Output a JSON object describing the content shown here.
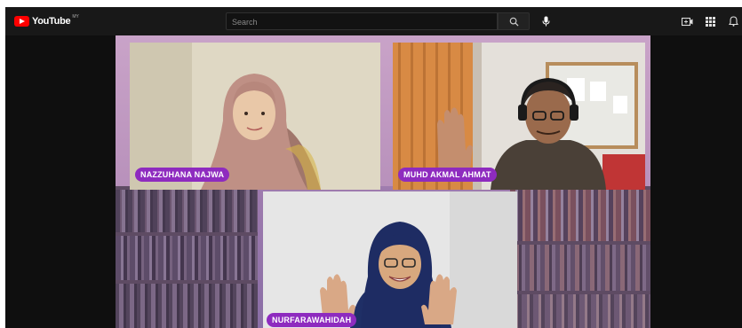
{
  "header": {
    "logo_text": "YouTube",
    "region_code": "MY",
    "search": {
      "placeholder": "Search",
      "value": ""
    },
    "icons": {
      "search": "search-icon",
      "mic": "mic-icon",
      "create": "create-video-icon",
      "apps": "apps-grid-icon",
      "notifications": "bell-icon"
    }
  },
  "video": {
    "participants": [
      {
        "name": "NAZZUHANA NAJWA"
      },
      {
        "name": "MUHD AKMAL AHMAT"
      },
      {
        "name": "NURFARAWAHIDAH"
      }
    ]
  },
  "colors": {
    "topbar": "#181818",
    "logo_red": "#ff0000",
    "name_tag": "#8e2bbf",
    "stage_purple": "#b58ab8"
  }
}
